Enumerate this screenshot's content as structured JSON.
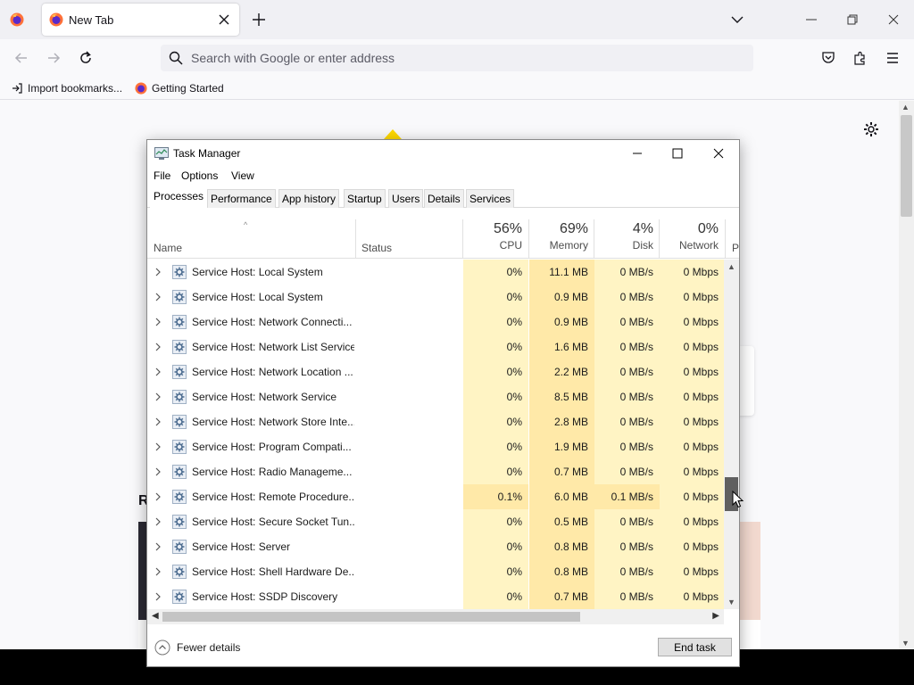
{
  "browser": {
    "tab": {
      "title": "New Tab"
    },
    "urlbar": {
      "placeholder": "Search with Google or enter address"
    },
    "bookmarks": [
      {
        "label": "Import bookmarks..."
      },
      {
        "label": "Getting Started"
      }
    ],
    "background": {
      "heading_fragment": "R"
    },
    "colors": {
      "chrome": "#f0f0f4",
      "page": "#f9f9fb",
      "accent": "#ffd900"
    }
  },
  "task_manager": {
    "title": "Task Manager",
    "menu": [
      "File",
      "Options",
      "View"
    ],
    "tabs": [
      "Processes",
      "Performance",
      "App history",
      "Startup",
      "Users",
      "Details",
      "Services"
    ],
    "active_tab": "Processes",
    "columns": {
      "name": "Name",
      "status": "Status",
      "cpu": {
        "pct": "56%",
        "label": "CPU"
      },
      "memory": {
        "pct": "69%",
        "label": "Memory"
      },
      "disk": {
        "pct": "4%",
        "label": "Disk"
      },
      "network": {
        "pct": "0%",
        "label": "Network"
      },
      "cut": "P"
    },
    "rows": [
      {
        "name": "Service Host: Local System",
        "cpu": "0%",
        "memory": "11.1 MB",
        "disk": "0 MB/s",
        "network": "0 Mbps"
      },
      {
        "name": "Service Host: Local System",
        "cpu": "0%",
        "memory": "0.9 MB",
        "disk": "0 MB/s",
        "network": "0 Mbps"
      },
      {
        "name": "Service Host: Network Connecti...",
        "cpu": "0%",
        "memory": "0.9 MB",
        "disk": "0 MB/s",
        "network": "0 Mbps"
      },
      {
        "name": "Service Host: Network List Service",
        "cpu": "0%",
        "memory": "1.6 MB",
        "disk": "0 MB/s",
        "network": "0 Mbps"
      },
      {
        "name": "Service Host: Network Location ...",
        "cpu": "0%",
        "memory": "2.2 MB",
        "disk": "0 MB/s",
        "network": "0 Mbps"
      },
      {
        "name": "Service Host: Network Service",
        "cpu": "0%",
        "memory": "8.5 MB",
        "disk": "0 MB/s",
        "network": "0 Mbps"
      },
      {
        "name": "Service Host: Network Store Inte...",
        "cpu": "0%",
        "memory": "2.8 MB",
        "disk": "0 MB/s",
        "network": "0 Mbps"
      },
      {
        "name": "Service Host: Program Compati...",
        "cpu": "0%",
        "memory": "1.9 MB",
        "disk": "0 MB/s",
        "network": "0 Mbps"
      },
      {
        "name": "Service Host: Radio Manageme...",
        "cpu": "0%",
        "memory": "0.7 MB",
        "disk": "0 MB/s",
        "network": "0 Mbps"
      },
      {
        "name": "Service Host: Remote Procedure...",
        "cpu": "0.1%",
        "memory": "6.0 MB",
        "disk": "0.1 MB/s",
        "network": "0 Mbps",
        "hot": true
      },
      {
        "name": "Service Host: Secure Socket Tun...",
        "cpu": "0%",
        "memory": "0.5 MB",
        "disk": "0 MB/s",
        "network": "0 Mbps"
      },
      {
        "name": "Service Host: Server",
        "cpu": "0%",
        "memory": "0.8 MB",
        "disk": "0 MB/s",
        "network": "0 Mbps"
      },
      {
        "name": "Service Host: Shell Hardware De...",
        "cpu": "0%",
        "memory": "0.8 MB",
        "disk": "0 MB/s",
        "network": "0 Mbps"
      },
      {
        "name": "Service Host: SSDP Discovery",
        "cpu": "0%",
        "memory": "0.7 MB",
        "disk": "0 MB/s",
        "network": "0 Mbps"
      }
    ],
    "footer": {
      "fewer_details": "Fewer details",
      "end_task": "End task"
    },
    "colors": {
      "heat_low": "#fff4c4",
      "heat_mid": "#ffe9a8"
    }
  }
}
